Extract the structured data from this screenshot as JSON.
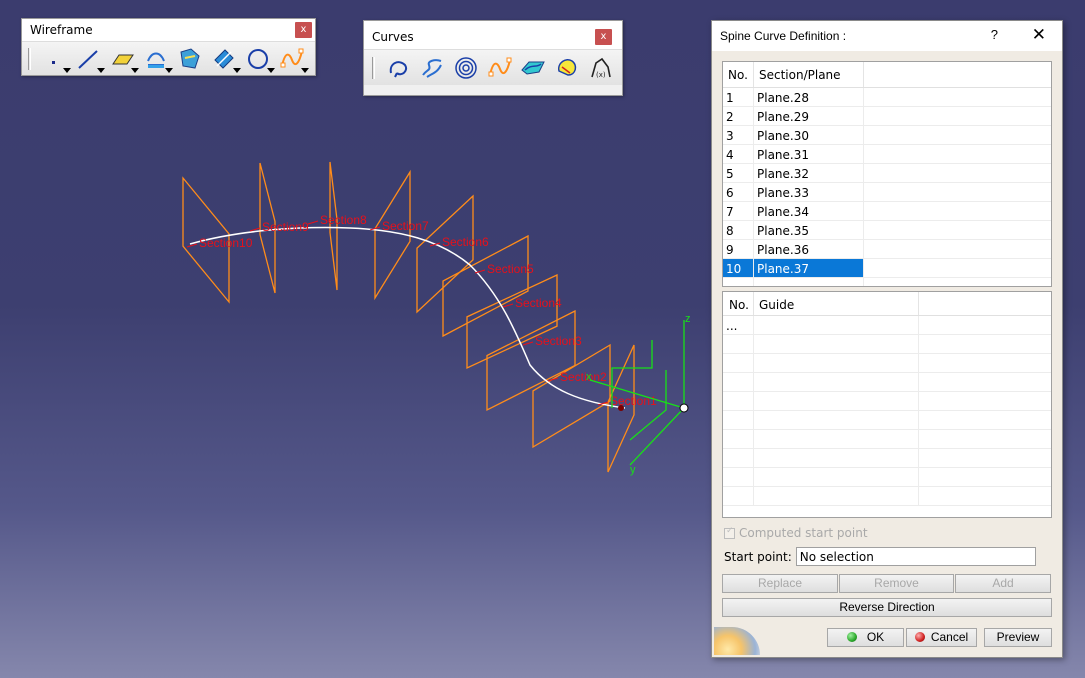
{
  "wireframe_toolbar": {
    "title": "Wireframe",
    "close": "x",
    "tools": [
      "point-icon",
      "line-icon",
      "plane-icon",
      "projection-icon",
      "combine-icon",
      "reflect-line-icon",
      "circle-icon",
      "spline-icon"
    ]
  },
  "curves_toolbar": {
    "title": "Curves",
    "close": "x",
    "tools": [
      "spiral-icon",
      "helix-icon",
      "spiral-coil-icon",
      "spline-icon",
      "connect-curve-icon",
      "spine-icon",
      "polyline-icon"
    ]
  },
  "viewport": {
    "section_labels": [
      "Section10",
      "Section9",
      "Section8",
      "Section7",
      "Section6",
      "Section5",
      "Section4",
      "Section3",
      "Section2",
      "Section1"
    ],
    "axis_labels": {
      "x": "x",
      "y": "y",
      "z": "z"
    },
    "colors": {
      "planes": "#ff8c1a",
      "labels": "#e8101a",
      "spine": "#ffffff",
      "axes": "#18e018"
    }
  },
  "dialog": {
    "title": "Spine Curve Definition :",
    "help": "?",
    "close": "✕",
    "sections_table": {
      "headers": [
        "No.",
        "Section/Plane"
      ],
      "rows": [
        [
          "1",
          "Plane.28"
        ],
        [
          "2",
          "Plane.29"
        ],
        [
          "3",
          "Plane.30"
        ],
        [
          "4",
          "Plane.31"
        ],
        [
          "5",
          "Plane.32"
        ],
        [
          "6",
          "Plane.33"
        ],
        [
          "7",
          "Plane.34"
        ],
        [
          "8",
          "Plane.35"
        ],
        [
          "9",
          "Plane.36"
        ],
        [
          "10",
          "Plane.37"
        ]
      ],
      "selected_row": 9
    },
    "guides_table": {
      "headers": [
        "No.",
        "Guide"
      ],
      "rows": [
        [
          "...",
          ""
        ]
      ]
    },
    "computed_start_point": "Computed start point",
    "start_point_label": "Start point:",
    "start_point_value": "No selection",
    "buttons": {
      "replace": "Replace",
      "remove": "Remove",
      "add": "Add",
      "reverse": "Reverse Direction",
      "ok": "OK",
      "cancel": "Cancel",
      "preview": "Preview"
    },
    "colors": {
      "selection": "#0a78d7",
      "ok_led": "#2aa82a",
      "cancel_led": "#d02020"
    }
  }
}
